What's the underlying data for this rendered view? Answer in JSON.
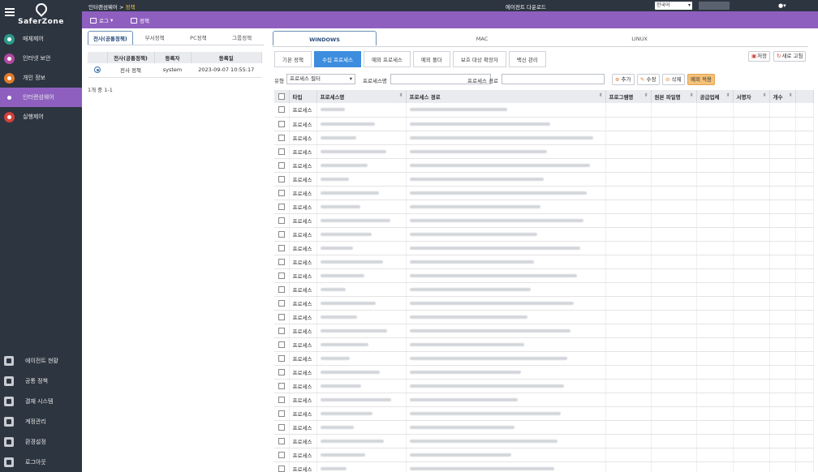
{
  "app": {
    "name": "SaferZone"
  },
  "topbar": {
    "breadcrumb": [
      "인터랜섬웨어",
      "정책"
    ],
    "agent_download": "에이전트 다운로드",
    "language": "한국어"
  },
  "toolbar": {
    "log_label": "로그",
    "policy_label": "정책"
  },
  "sidebar": {
    "items": [
      {
        "label": "매체제어",
        "icon": "shield-icon",
        "color": "#2b9a8c"
      },
      {
        "label": "인터넷 보안",
        "icon": "globe-icon",
        "color": "#b04aa0"
      },
      {
        "label": "개인 정보",
        "icon": "person-icon",
        "color": "#e07a2a"
      },
      {
        "label": "인터랜섬웨어",
        "icon": "ransomware-icon",
        "color": "#8e5fbf"
      },
      {
        "label": "실행제어",
        "icon": "execute-icon",
        "color": "#d0423a"
      }
    ],
    "bottom_items": [
      {
        "label": "에이전트 현황",
        "icon": "agent-icon"
      },
      {
        "label": "공통 정책",
        "icon": "policy-icon"
      },
      {
        "label": "결재 시스템",
        "icon": "approval-icon"
      },
      {
        "label": "계정관리",
        "icon": "account-icon"
      },
      {
        "label": "환경설정",
        "icon": "gear-icon"
      },
      {
        "label": "로그아웃",
        "icon": "logout-icon"
      }
    ]
  },
  "left_panel": {
    "tabs": [
      "전사(공통정책)",
      "부서정책",
      "PC정책",
      "그룹정책"
    ],
    "columns": [
      "",
      "전사(공통정책)",
      "등록자",
      "등록일"
    ],
    "rows": [
      {
        "name": "전사 정책",
        "registrant": "system",
        "date": "2023-09-07 10:55:17"
      }
    ],
    "count": "1개 중 1-1"
  },
  "os_tabs": [
    "WINDOWS",
    "MAC",
    "LINUX"
  ],
  "sub_tabs": [
    "기본 정책",
    "수집 프로세스",
    "예외 프로세스",
    "예외 폴더",
    "보호 대상 확장자",
    "백신 관리"
  ],
  "actions": {
    "save": "저장",
    "refresh": "새로 고침",
    "add": "추가",
    "edit": "수정",
    "delete": "삭제",
    "apply_exception": "예외 적용"
  },
  "filter": {
    "type_label": "유형",
    "type_value": "프로세스 필터",
    "process_name_label": "프로세스명",
    "process_path_label": "프로세스 경로"
  },
  "grid": {
    "columns": [
      "",
      "타입",
      "프로세스명",
      "프로세스 경로",
      "프로그램명",
      "원본 파일명",
      "공급업체",
      "서명자",
      "개수",
      ""
    ],
    "row_type": "프로세스",
    "row_count": 28
  }
}
